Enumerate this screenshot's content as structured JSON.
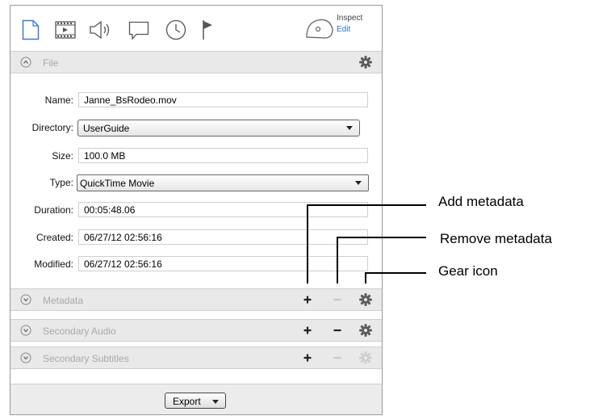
{
  "toolbar": {
    "icons": [
      "file-icon",
      "movie-icon",
      "audio-icon",
      "subtitle-icon",
      "clock-icon",
      "flag-icon"
    ],
    "inspect_label": "Inspect",
    "edit_label": "Edit"
  },
  "file_section": {
    "title": "File",
    "fields": {
      "name": {
        "label": "Name:",
        "value": "Janne_BsRodeo.mov"
      },
      "directory": {
        "label": "Directory:",
        "value": "UserGuide"
      },
      "size": {
        "label": "Size:",
        "value": "100.0 MB"
      },
      "type": {
        "label": "Type:",
        "value": "QuickTime Movie"
      },
      "duration": {
        "label": "Duration:",
        "value": "00:05:48.06"
      },
      "created": {
        "label": "Created:",
        "value": "06/27/12 02:56:16"
      },
      "modified": {
        "label": "Modified:",
        "value": "06/27/12 02:56:16"
      }
    }
  },
  "sections": [
    {
      "title": "Metadata"
    },
    {
      "title": "Secondary Audio"
    },
    {
      "title": "Secondary Subtitles"
    }
  ],
  "footer": {
    "export_label": "Export"
  },
  "callouts": {
    "add": "Add metadata",
    "remove": "Remove metadata",
    "gear": "Gear icon"
  },
  "colors": {
    "edit_link": "#2a6fd6",
    "header_bg": "#e9e9e9",
    "muted_text": "#a9a9a9"
  }
}
